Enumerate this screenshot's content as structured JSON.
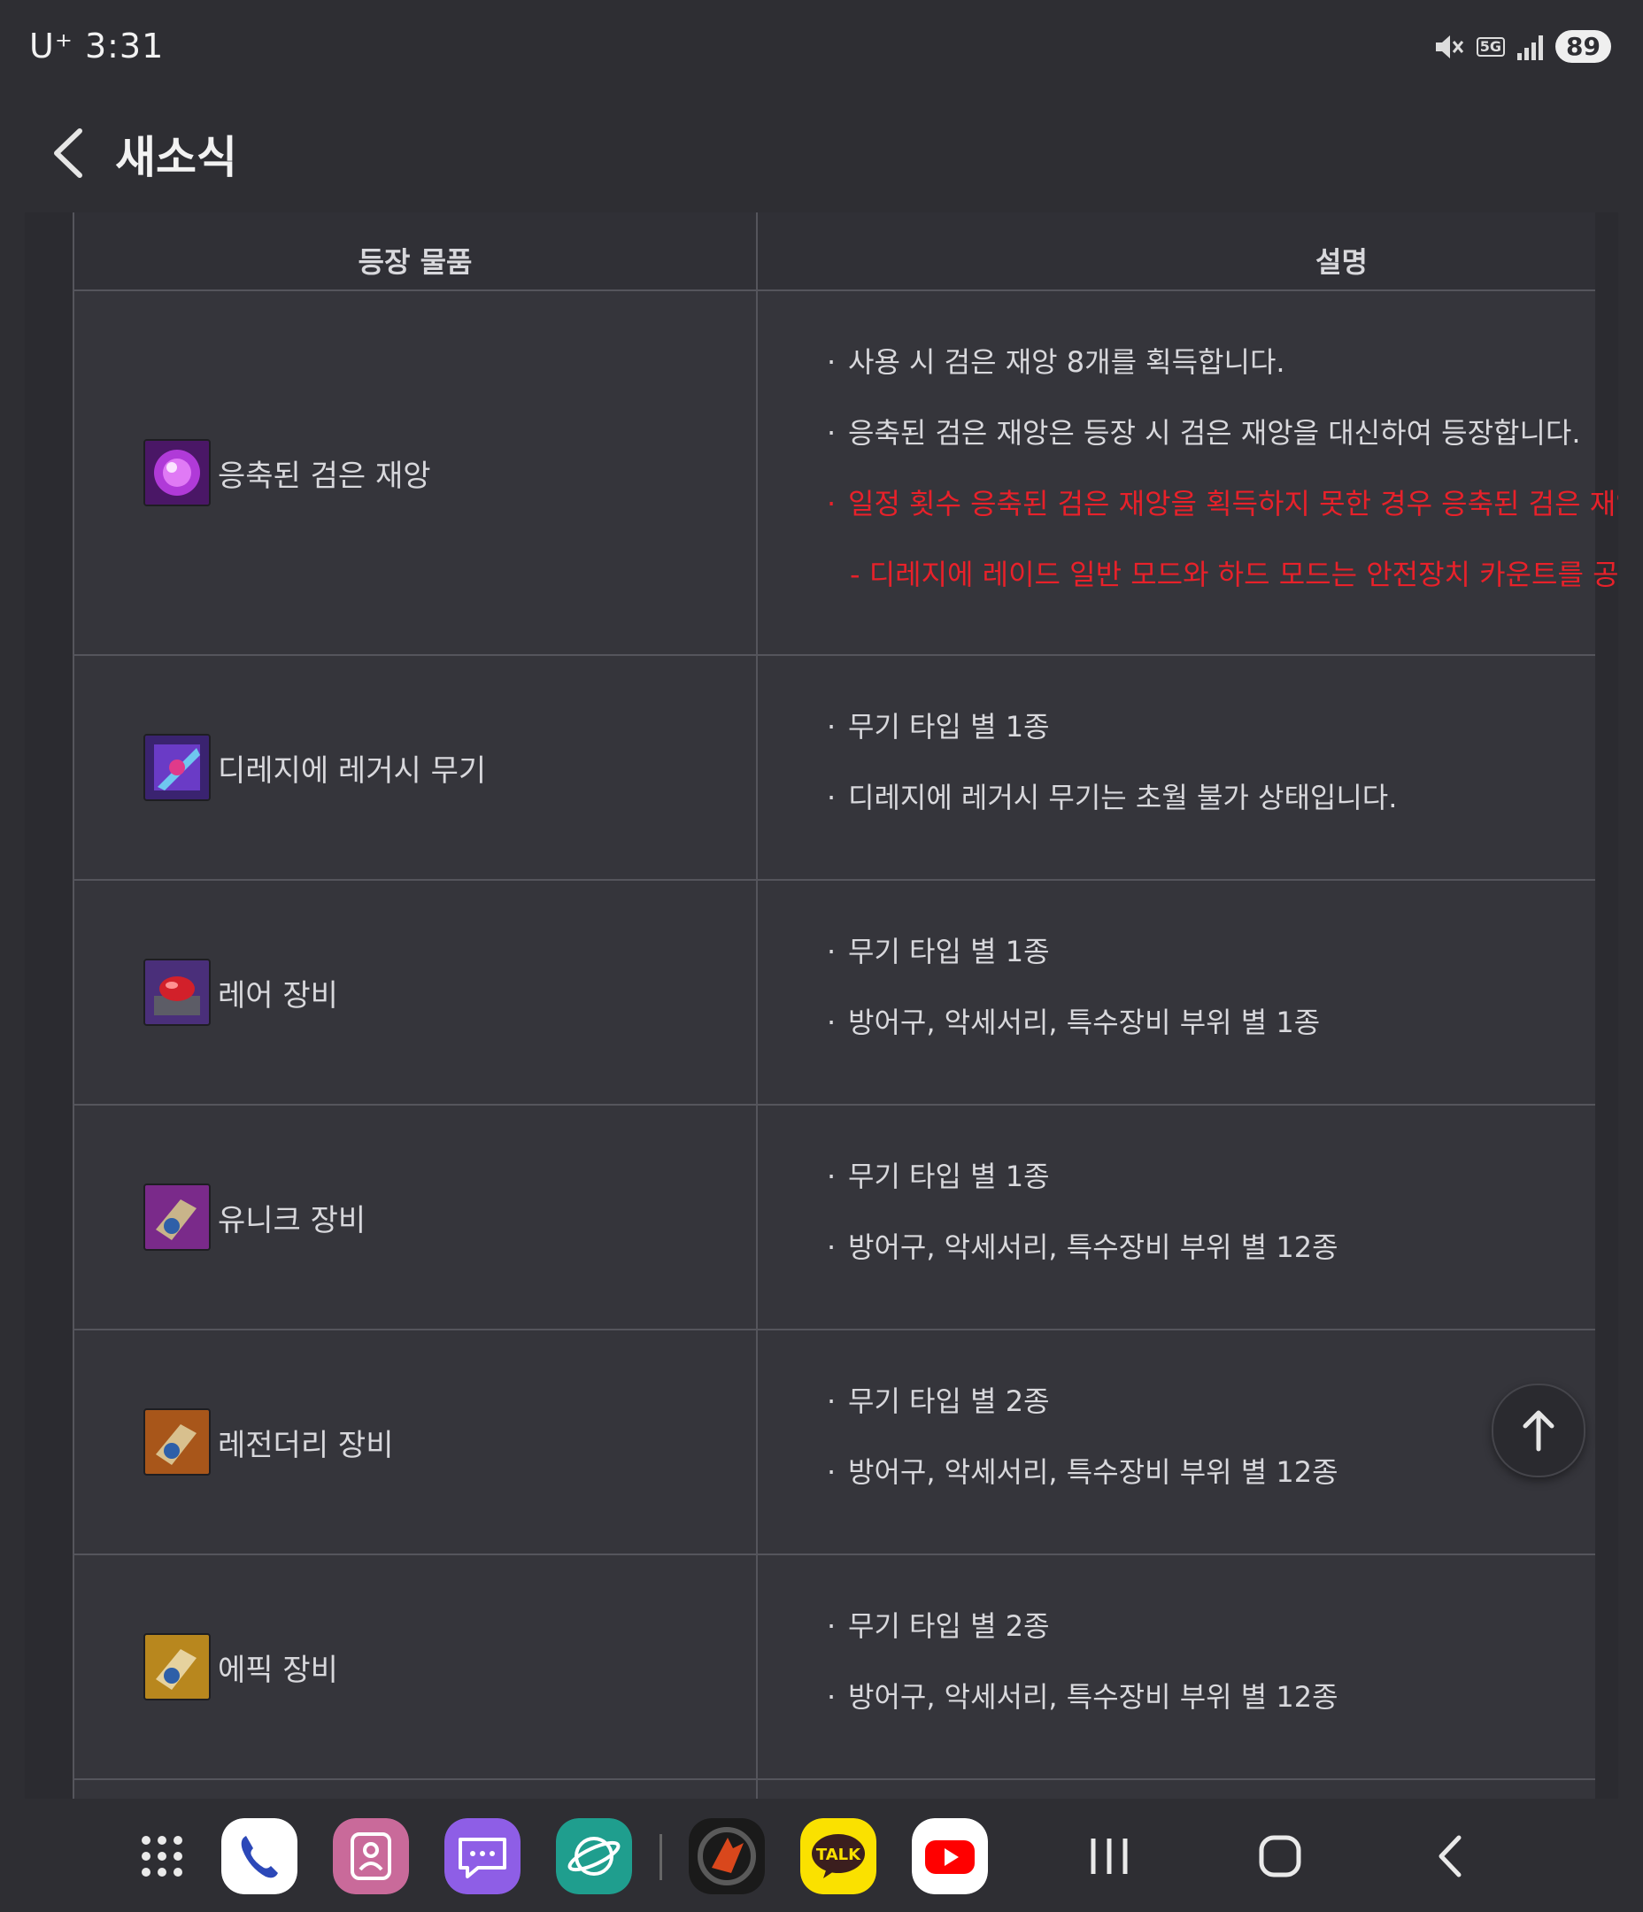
{
  "status": {
    "carrier_time": "U⁺ 3:31",
    "network": "5G",
    "battery": "89"
  },
  "header": {
    "title": "새소식"
  },
  "table": {
    "headers": [
      "등장 물품",
      "설명"
    ],
    "rows": [
      {
        "name": "응축된 검은 재앙",
        "lines": [
          {
            "text": "사용 시 검은 재앙 8개를 획득합니다.",
            "style": "normal"
          },
          {
            "text": "응축된 검은 재앙은 등장 시 검은 재앙을 대신하여 등장합니다.",
            "style": "normal"
          },
          {
            "text": "일정 횟수 응축된 검은 재앙을 획득하지 못한 경우 응축된 검은 재앙을",
            "style": "red"
          },
          {
            "text": "- 디레지에 레이드 일반 모드와 하드 모드는 안전장치 카운트를 공유합",
            "style": "red-indent"
          }
        ]
      },
      {
        "name": "디레지에 레거시 무기",
        "lines": [
          {
            "text": "무기 타입 별 1종",
            "style": "normal"
          },
          {
            "text": "디레지에 레거시 무기는 초월 불가 상태입니다.",
            "style": "normal"
          }
        ]
      },
      {
        "name": "레어 장비",
        "lines": [
          {
            "text": "무기 타입 별 1종",
            "style": "normal"
          },
          {
            "text": "방어구, 악세서리, 특수장비 부위 별 1종",
            "style": "normal"
          }
        ]
      },
      {
        "name": "유니크 장비",
        "lines": [
          {
            "text": "무기 타입 별 1종",
            "style": "normal"
          },
          {
            "text": "방어구, 악세서리, 특수장비 부위 별 12종",
            "style": "normal"
          }
        ]
      },
      {
        "name": "레전더리 장비",
        "lines": [
          {
            "text": "무기 타입 별 2종",
            "style": "normal"
          },
          {
            "text": "방어구, 악세서리, 특수장비 부위 별 12종",
            "style": "normal"
          }
        ]
      },
      {
        "name": "에픽 장비",
        "lines": [
          {
            "text": "무기 타입 별 2종",
            "style": "normal"
          },
          {
            "text": "방어구, 악세서리, 특수장비 부위 별 12종",
            "style": "normal"
          }
        ]
      }
    ]
  },
  "dock": {
    "apps": [
      "apps-grid-icon",
      "phone-icon",
      "contacts-icon",
      "messages-icon",
      "browser-icon",
      "dnf-game-icon",
      "kakaotalk-icon",
      "youtube-icon"
    ],
    "talk_label": "TALK"
  },
  "colors": {
    "background": "#2e2e33",
    "cell": "#35353b",
    "warning": "#e8212a"
  }
}
